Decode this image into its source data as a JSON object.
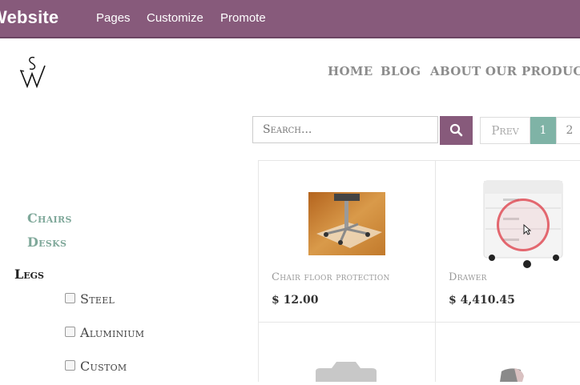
{
  "adminbar": {
    "brand": "Website",
    "menu": [
      "Pages",
      "Customize",
      "Promote"
    ],
    "color": "#875a7b"
  },
  "logo": {
    "icon": "sw-monogram-icon"
  },
  "nav": {
    "items": [
      "HOME",
      "BLOG",
      "ABOUT OUR PRODUCTS"
    ]
  },
  "search": {
    "placeholder": "Search...",
    "icon": "search-icon"
  },
  "pager": {
    "prev": "Prev",
    "pages": [
      "1",
      "2"
    ],
    "active": "1",
    "active_color": "#7fb3a6"
  },
  "sidebar": {
    "categories": [
      "Chairs",
      "Desks"
    ],
    "legs_title": "Legs",
    "legs_options": [
      "Steel",
      "Aluminium",
      "Custom"
    ]
  },
  "products": [
    {
      "name": "Chair floor protection",
      "price": "$ 12.00"
    },
    {
      "name": "Drawer",
      "price": "$ 4,410.45"
    }
  ]
}
